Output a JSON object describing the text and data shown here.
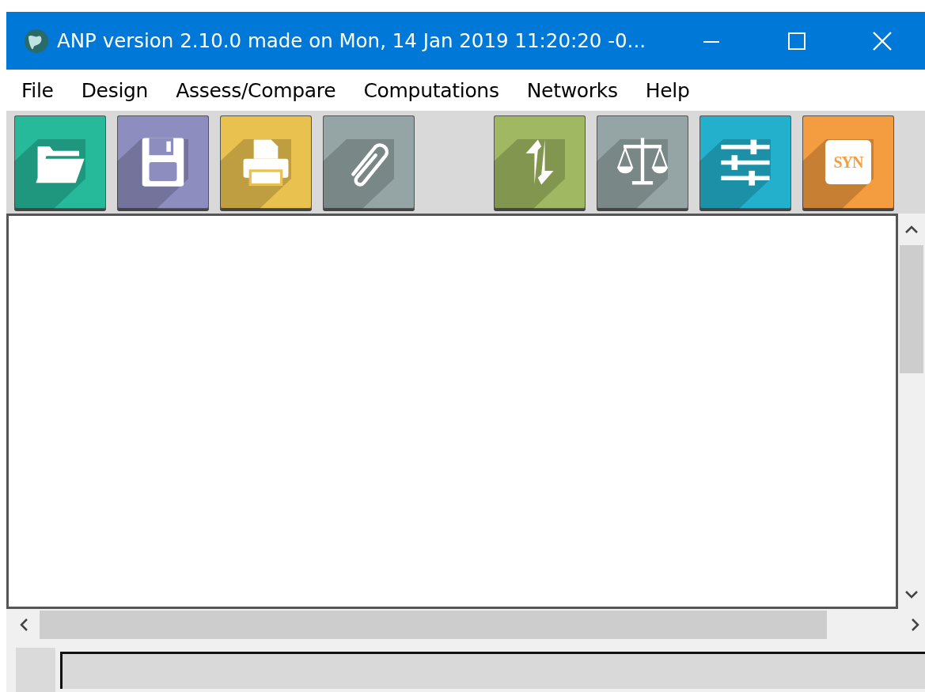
{
  "window": {
    "title": "ANP version 2.10.0 made on Mon, 14 Jan 2019 11:20:20 -0..."
  },
  "menu": [
    {
      "label": "File"
    },
    {
      "label": "Design"
    },
    {
      "label": "Assess/Compare"
    },
    {
      "label": "Computations"
    },
    {
      "label": "Networks"
    },
    {
      "label": "Help"
    }
  ],
  "toolbar": [
    {
      "kind": "open",
      "color": "#26b99a"
    },
    {
      "kind": "save",
      "color": "#8e8dbf"
    },
    {
      "kind": "print",
      "color": "#e8c14f"
    },
    {
      "kind": "attach",
      "color": "#95a5a5"
    },
    {
      "kind": "spacer"
    },
    {
      "kind": "refresh",
      "color": "#a0b862"
    },
    {
      "kind": "balance",
      "color": "#95a5a5"
    },
    {
      "kind": "sliders",
      "color": "#22b0cc"
    },
    {
      "kind": "text",
      "color": "#f39c40",
      "label": "SYN"
    }
  ]
}
